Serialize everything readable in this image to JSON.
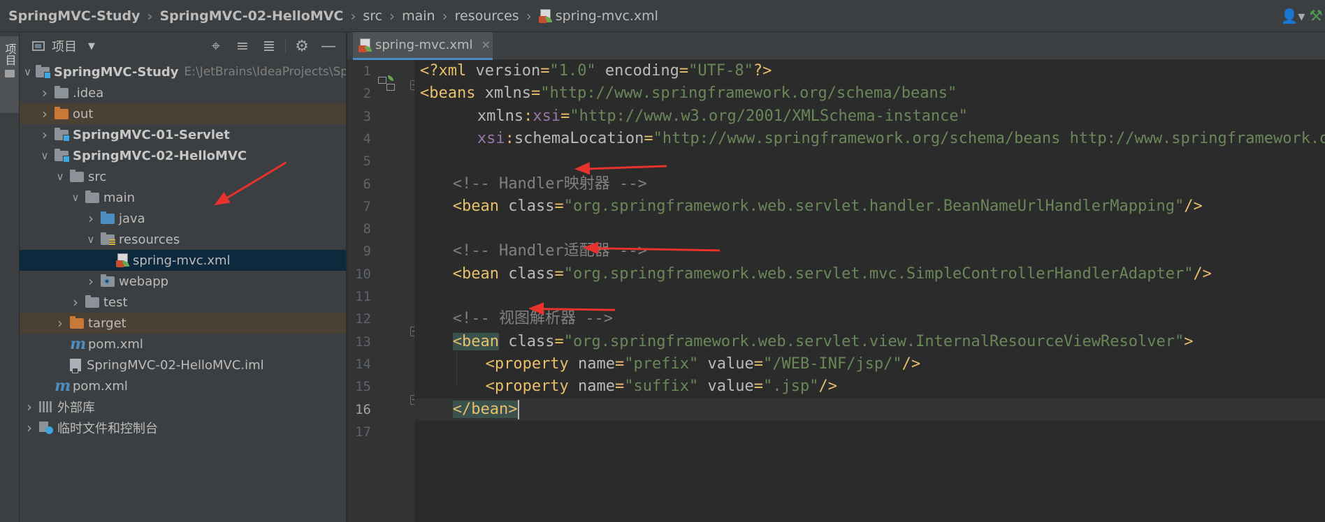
{
  "breadcrumb": {
    "items": [
      {
        "label": "SpringMVC-Study",
        "bold": true
      },
      {
        "label": "SpringMVC-02-HelloMVC",
        "bold": true
      },
      {
        "label": "src",
        "bold": false
      },
      {
        "label": "main",
        "bold": false
      },
      {
        "label": "resources",
        "bold": false
      },
      {
        "label": "spring-mvc.xml",
        "bold": false
      }
    ]
  },
  "nav_right_icons": [
    "user-icon",
    "hammer-icon"
  ],
  "stripe": {
    "label": "项目"
  },
  "project_panel": {
    "title": "项目",
    "tools": [
      "locate-icon",
      "expand-all-icon",
      "collapse-all-icon",
      "gear-icon",
      "hide-icon"
    ]
  },
  "tree": [
    {
      "label": "SpringMVC-Study",
      "hint": "E:\\JetBrains\\IdeaProjects\\Sp",
      "depth": 0,
      "chevron": "down",
      "icon": "module-folder",
      "bold": true,
      "state": ""
    },
    {
      "label": ".idea",
      "depth": 1,
      "chevron": "right",
      "icon": "folder",
      "bold": false,
      "state": ""
    },
    {
      "label": "out",
      "depth": 1,
      "chevron": "right",
      "icon": "folder-orange",
      "bold": false,
      "state": "excluded"
    },
    {
      "label": "SpringMVC-01-Servlet",
      "depth": 1,
      "chevron": "right",
      "icon": "module-folder",
      "bold": true,
      "state": ""
    },
    {
      "label": "SpringMVC-02-HelloMVC",
      "depth": 1,
      "chevron": "down",
      "icon": "module-folder",
      "bold": true,
      "state": ""
    },
    {
      "label": "src",
      "depth": 2,
      "chevron": "down",
      "icon": "folder",
      "bold": false,
      "state": ""
    },
    {
      "label": "main",
      "depth": 3,
      "chevron": "down",
      "icon": "folder",
      "bold": false,
      "state": ""
    },
    {
      "label": "java",
      "depth": 4,
      "chevron": "right",
      "icon": "folder-blue",
      "bold": false,
      "state": ""
    },
    {
      "label": "resources",
      "depth": 4,
      "chevron": "down",
      "icon": "folder-resources",
      "bold": false,
      "state": ""
    },
    {
      "label": "spring-mvc.xml",
      "depth": 5,
      "chevron": "none",
      "icon": "xml-file",
      "bold": false,
      "state": "selected"
    },
    {
      "label": "webapp",
      "depth": 4,
      "chevron": "right",
      "icon": "folder-web",
      "bold": false,
      "state": ""
    },
    {
      "label": "test",
      "depth": 3,
      "chevron": "right",
      "icon": "folder",
      "bold": false,
      "state": ""
    },
    {
      "label": "target",
      "depth": 2,
      "chevron": "right",
      "icon": "folder-orange",
      "bold": false,
      "state": "excluded"
    },
    {
      "label": "pom.xml",
      "depth": 2,
      "chevron": "none",
      "icon": "maven",
      "bold": false,
      "state": ""
    },
    {
      "label": "SpringMVC-02-HelloMVC.iml",
      "depth": 2,
      "chevron": "none",
      "icon": "iml",
      "bold": false,
      "state": ""
    },
    {
      "label": "pom.xml",
      "depth": 1,
      "chevron": "none",
      "icon": "maven",
      "bold": false,
      "state": ""
    },
    {
      "label": "外部库",
      "depth": 0,
      "chevron": "right",
      "icon": "library",
      "bold": false,
      "state": ""
    },
    {
      "label": "临时文件和控制台",
      "depth": 0,
      "chevron": "right",
      "icon": "scratch",
      "bold": false,
      "state": ""
    }
  ],
  "editor": {
    "tab_label": "spring-mvc.xml",
    "current_line": 16,
    "lines": [
      {
        "n": "1",
        "indent": 0,
        "tokens": [
          [
            "tag",
            "<?xml "
          ],
          [
            "attr",
            "version"
          ],
          [
            "tag",
            "="
          ],
          [
            "str",
            "\"1.0\""
          ],
          [
            "attr",
            " encoding"
          ],
          [
            "tag",
            "="
          ],
          [
            "str",
            "\"UTF-8\""
          ],
          [
            "tag",
            "?>"
          ]
        ]
      },
      {
        "n": "2",
        "indent": 0,
        "tokens": [
          [
            "tag",
            "<beans "
          ],
          [
            "attr",
            "xmlns"
          ],
          [
            "tag",
            "="
          ],
          [
            "str",
            "\"http://www.springframework.org/schema/beans\""
          ]
        ]
      },
      {
        "n": "3",
        "indent": 7,
        "tokens": [
          [
            "attr",
            "xmlns"
          ],
          [
            "tag",
            ":"
          ],
          [
            "ns",
            "xsi"
          ],
          [
            "tag",
            "="
          ],
          [
            "str",
            "\"http://www.w3.org/2001/XMLSchema-instance\""
          ]
        ]
      },
      {
        "n": "4",
        "indent": 7,
        "tokens": [
          [
            "ns",
            "xsi"
          ],
          [
            "tag",
            ":"
          ],
          [
            "attr",
            "schemaLocation"
          ],
          [
            "tag",
            "="
          ],
          [
            "str",
            "\"http://www.springframework.org/schema/beans http://www.springframework.org/schema/beans/spring-beans.xsd\""
          ]
        ]
      },
      {
        "n": "5",
        "indent": 0,
        "tokens": []
      },
      {
        "n": "6",
        "indent": 4,
        "tokens": [
          [
            "com",
            "<!-- Handler映射器 -->"
          ]
        ]
      },
      {
        "n": "7",
        "indent": 4,
        "tokens": [
          [
            "tag",
            "<bean "
          ],
          [
            "attr",
            "class"
          ],
          [
            "tag",
            "="
          ],
          [
            "str",
            "\"org.springframework.web.servlet.handler.BeanNameUrlHandlerMapping\""
          ],
          [
            "tag",
            "/>"
          ]
        ]
      },
      {
        "n": "8",
        "indent": 0,
        "tokens": []
      },
      {
        "n": "9",
        "indent": 4,
        "tokens": [
          [
            "com",
            "<!-- Handler适配器 -->"
          ]
        ]
      },
      {
        "n": "10",
        "indent": 4,
        "tokens": [
          [
            "tag",
            "<bean "
          ],
          [
            "attr",
            "class"
          ],
          [
            "tag",
            "="
          ],
          [
            "str",
            "\"org.springframework.web.servlet.mvc.SimpleControllerHandlerAdapter\""
          ],
          [
            "tag",
            "/>"
          ]
        ]
      },
      {
        "n": "11",
        "indent": 0,
        "tokens": []
      },
      {
        "n": "12",
        "indent": 4,
        "tokens": [
          [
            "com",
            "<!-- 视图解析器 -->"
          ]
        ]
      },
      {
        "n": "13",
        "indent": 4,
        "tokens": [
          [
            "tag-hl",
            "<bean"
          ],
          [
            "attr",
            " class"
          ],
          [
            "tag",
            "="
          ],
          [
            "str",
            "\"org.springframework.web.servlet.view.InternalResourceViewResolver\""
          ],
          [
            "tag",
            ">"
          ]
        ]
      },
      {
        "n": "14",
        "indent": 8,
        "tokens": [
          [
            "tag",
            "<property "
          ],
          [
            "attr",
            "name"
          ],
          [
            "tag",
            "="
          ],
          [
            "str",
            "\"prefix\""
          ],
          [
            "attr",
            " value"
          ],
          [
            "tag",
            "="
          ],
          [
            "str",
            "\"/WEB-INF/jsp/\""
          ],
          [
            "tag",
            "/>"
          ]
        ]
      },
      {
        "n": "15",
        "indent": 8,
        "tokens": [
          [
            "tag",
            "<property "
          ],
          [
            "attr",
            "name"
          ],
          [
            "tag",
            "="
          ],
          [
            "str",
            "\"suffix\""
          ],
          [
            "attr",
            " value"
          ],
          [
            "tag",
            "="
          ],
          [
            "str",
            "\".jsp\""
          ],
          [
            "tag",
            "/>"
          ]
        ]
      },
      {
        "n": "16",
        "indent": 4,
        "tokens": [
          [
            "tag-hl",
            "</bean>"
          ],
          [
            "caret",
            ""
          ]
        ]
      },
      {
        "n": "17",
        "indent": 0,
        "tokens": []
      }
    ]
  },
  "colors": {
    "tag": "#e8bf6a",
    "attribute": "#bababa",
    "namespace": "#9876aa",
    "string": "#6a8759",
    "comment": "#808080",
    "annotation_arrow": "#e8322d",
    "selection": "#0d293e"
  }
}
